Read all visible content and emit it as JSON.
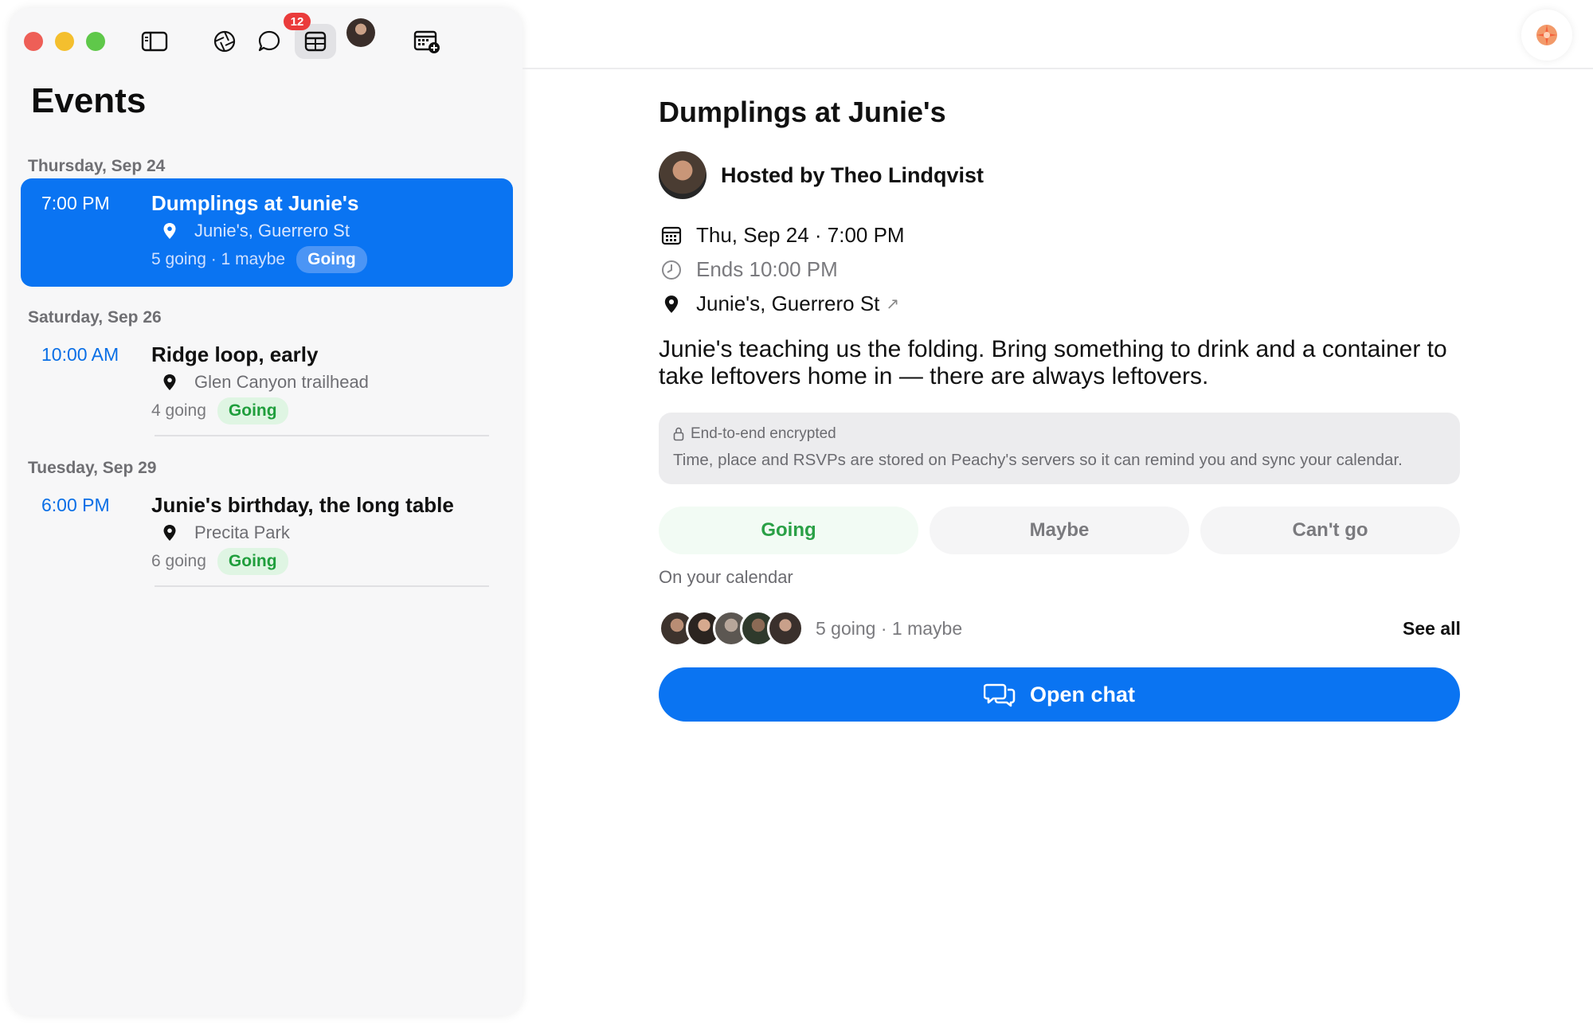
{
  "toolbar": {
    "notification_count": "12"
  },
  "sidebar": {
    "title": "Events",
    "groups": [
      {
        "day": "Thursday, Sep 24",
        "event": {
          "time": "7:00 PM",
          "title": "Dumplings at Junie's",
          "location": "Junie's, Guerrero St",
          "counts": "5 going · 1 maybe",
          "status": "Going"
        }
      },
      {
        "day": "Saturday, Sep 26",
        "event": {
          "time": "10:00 AM",
          "title": "Ridge loop, early",
          "location": "Glen Canyon trailhead",
          "counts": "4 going",
          "status": "Going"
        }
      },
      {
        "day": "Tuesday, Sep 29",
        "event": {
          "time": "6:00 PM",
          "title": "Junie's birthday, the long table",
          "location": "Precita Park",
          "counts": "6 going",
          "status": "Going"
        }
      }
    ]
  },
  "detail": {
    "title": "Dumplings at Junie's",
    "host": "Hosted by Theo Lindqvist",
    "datetime": "Thu, Sep 24 · 7:00 PM",
    "ends": "Ends 10:00 PM",
    "location": "Junie's, Guerrero St",
    "external_arrow": "↗",
    "description": "Junie's teaching us the folding. Bring something to drink and a container to take leftovers home in — there are always leftovers.",
    "encryption": {
      "title": "End-to-end encrypted",
      "body": "Time, place and RSVPs are stored on Peachy's servers so it can remind you and sync your calendar."
    },
    "rsvp": {
      "going": "Going",
      "maybe": "Maybe",
      "cant": "Can't go"
    },
    "calendar_note": "On your calendar",
    "attendee_counts": "5 going · 1 maybe",
    "see_all": "See all",
    "open_chat": "Open chat"
  },
  "colors": {
    "accent": "#0a74f2",
    "going_green": "#2aa046",
    "badge_red": "#ea3b3b"
  }
}
